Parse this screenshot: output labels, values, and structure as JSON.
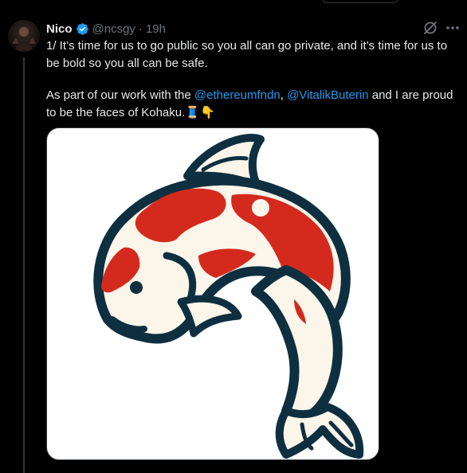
{
  "tweet": {
    "author_name": "Nico",
    "handle": "@ncsgy",
    "separator": "·",
    "time": "19h",
    "paragraph1": "1/ It’s time for us to go public so you all can go private, and it’s time for us to be bold so you all can be safe.",
    "p2_prefix": "As part of our work with the ",
    "mention1": "@ethereumfndn",
    "p2_comma": ", ",
    "mention2": "@VitalikButerin",
    "p2_suffix": " and I are proud to be the faces of Kohaku.",
    "emoji": "🧵👇",
    "verified": true,
    "icons": [
      "verified-badge-icon",
      "grok-icon",
      "more-options-icon"
    ]
  },
  "colors": {
    "background": "#000000",
    "text": "#e7e9ea",
    "secondary": "#71767b",
    "link": "#1d9bf0",
    "koi_outline": "#0e2f3f",
    "koi_red": "#d42a1e",
    "koi_cream": "#fbf5ea"
  }
}
